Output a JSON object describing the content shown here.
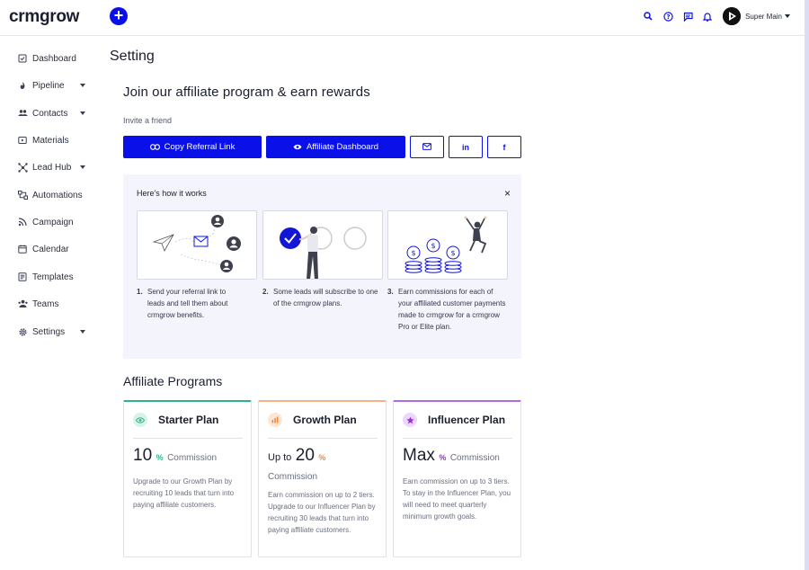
{
  "app": {
    "logo": "crmgrow",
    "add_label": "+"
  },
  "header": {
    "icons": [
      "search-icon",
      "help-icon",
      "chat-icon",
      "bell-icon"
    ],
    "user_name": "Super Main"
  },
  "sidebar": {
    "items": [
      {
        "label": "Dashboard",
        "icon": "dashboard-icon",
        "dropdown": false
      },
      {
        "label": "Pipeline",
        "icon": "pipeline-icon",
        "dropdown": true
      },
      {
        "label": "Contacts",
        "icon": "contacts-icon",
        "dropdown": true
      },
      {
        "label": "Materials",
        "icon": "materials-icon",
        "dropdown": false
      },
      {
        "label": "Lead Hub",
        "icon": "lead-hub-icon",
        "dropdown": true
      },
      {
        "label": "Automations",
        "icon": "automations-icon",
        "dropdown": false
      },
      {
        "label": "Campaign",
        "icon": "campaign-icon",
        "dropdown": false
      },
      {
        "label": "Calendar",
        "icon": "calendar-icon",
        "dropdown": false
      },
      {
        "label": "Templates",
        "icon": "templates-icon",
        "dropdown": false
      },
      {
        "label": "Teams",
        "icon": "teams-icon",
        "dropdown": false
      },
      {
        "label": "Settings",
        "icon": "settings-icon",
        "dropdown": true
      }
    ]
  },
  "main": {
    "page_title": "Setting",
    "join_title": "Join our affiliate program & earn rewards",
    "invite_label": "Invite a friend",
    "copy_referral_label": "Copy Referral Link",
    "affiliate_dashboard_label": "Affiliate Dashboard",
    "social": {
      "linkedin": "in",
      "facebook": "f"
    }
  },
  "how_it_works": {
    "title": "Here's how it works",
    "close": "×",
    "steps": [
      {
        "num": "1.",
        "text": "Send your referral link to leads and tell them about crmgrow benefits."
      },
      {
        "num": "2.",
        "text": "Some leads will subscribe to one of the crmgrow plans."
      },
      {
        "num": "3.",
        "text": "Earn commissions for each of your affiliated customer payments made to crmgrow for a crmgrow Pro or Elite plan."
      }
    ]
  },
  "affiliate_programs": {
    "title": "Affiliate Programs",
    "plans": [
      {
        "name": "Starter Plan",
        "prefix": "",
        "value": "10",
        "pct": "%",
        "commission_label": "Commission",
        "description": "Upgrade to our Growth Plan by recruiting 10 leads that turn into paying affiliate customers.",
        "color": "#2fb389"
      },
      {
        "name": "Growth Plan",
        "prefix": "Up to",
        "value": "20",
        "pct": "%",
        "commission_label": "Commission",
        "description": "Earn commission on up to 2 tiers. Upgrade to our Influencer Plan by recruiting 30 leads that turn into paying affiliate customers.",
        "color": "#f5893a"
      },
      {
        "name": "Influencer Plan",
        "prefix": "",
        "value": "Max",
        "pct": "%",
        "commission_label": "Commission",
        "description": "Earn commission on up to 3 tiers. To stay in the Influencer Plan, you will need to meet quarterly minimum growth goals.",
        "color": "#9a2fd8"
      }
    ]
  },
  "colors": {
    "primary": "#0a10e8",
    "panel": "#f4f4fd"
  }
}
